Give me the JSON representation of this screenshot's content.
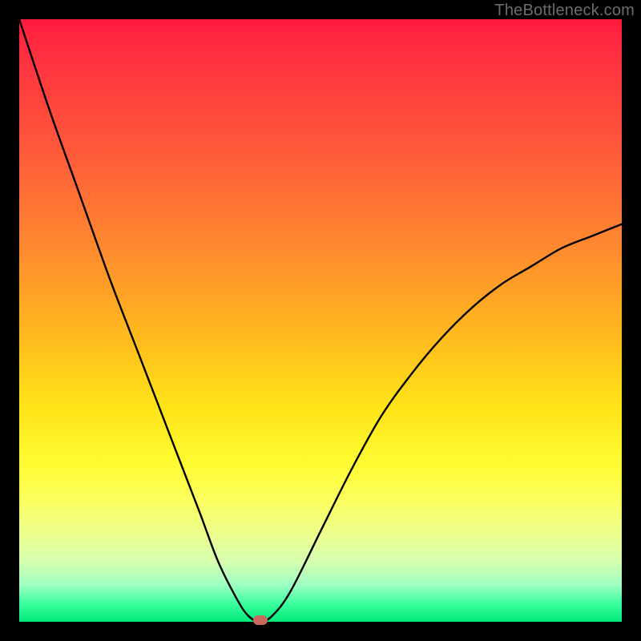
{
  "watermark": "TheBottleneck.com",
  "colors": {
    "frame": "#000000",
    "gradient_top": "#ff1a3e",
    "gradient_bottom": "#00e87a",
    "curve": "#000000",
    "marker": "#c96a5e"
  },
  "chart_data": {
    "type": "line",
    "title": "",
    "xlabel": "",
    "ylabel": "",
    "xlim": [
      0,
      100
    ],
    "ylim": [
      0,
      100
    ],
    "grid": false,
    "legend": false,
    "series": [
      {
        "name": "bottleneck-curve",
        "x": [
          0,
          5,
          10,
          15,
          20,
          25,
          30,
          33,
          36,
          38,
          40,
          42,
          45,
          50,
          55,
          60,
          65,
          70,
          75,
          80,
          85,
          90,
          95,
          100
        ],
        "y": [
          100,
          85,
          71,
          57,
          44,
          31,
          18,
          10,
          4,
          1,
          0,
          1,
          5,
          15,
          25,
          34,
          41,
          47,
          52,
          56,
          59,
          62,
          64,
          66
        ]
      }
    ],
    "marker": {
      "x": 40,
      "y": 0
    },
    "notes": "V-shaped curve; minimum (0% bottleneck) near x≈40. Values estimated from pixel positions."
  }
}
